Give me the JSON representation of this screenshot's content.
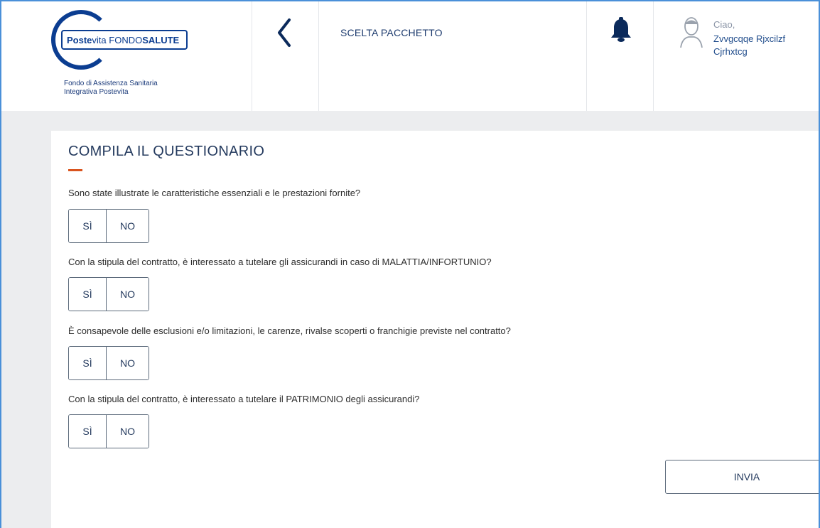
{
  "header": {
    "logo": {
      "brand_bold_1": "Poste",
      "brand_thin_1": "vita",
      "brand_thin_2": "FONDO",
      "brand_bold_2": "SALUTE",
      "subtitle_line1": "Fondo di Assistenza Sanitaria",
      "subtitle_line2": "Integrativa Postevita"
    },
    "back_icon": "chevron-left",
    "page_title": "SCELTA PACCHETTO",
    "bell_icon": "bell",
    "user": {
      "greeting": "Ciao,",
      "name_line1": "Zvvgcqqe Rjxcilzf",
      "name_line2": "Cjrhxtcg"
    }
  },
  "form": {
    "title": "COMPILA IL QUESTIONARIO",
    "accent_color": "#d9541e",
    "questions": [
      {
        "text": "Sono state illustrate le caratteristiche essenziali e le prestazioni fornite?",
        "yes": "SÌ",
        "no": "NO"
      },
      {
        "text": "Con la stipula del contratto, è interessato a tutelare gli assicurandi in caso di MALATTIA/INFORTUNIO?",
        "yes": "SÌ",
        "no": "NO"
      },
      {
        "text": "È consapevole delle esclusioni e/o limitazioni, le carenze, rivalse scoperti o franchigie previste nel contratto?",
        "yes": "SÌ",
        "no": "NO"
      },
      {
        "text": "Con la stipula del contratto, è interessato a tutelare il PATRIMONIO degli assicurandi?",
        "yes": "SÌ",
        "no": "NO"
      }
    ],
    "submit_label": "INVIA"
  }
}
